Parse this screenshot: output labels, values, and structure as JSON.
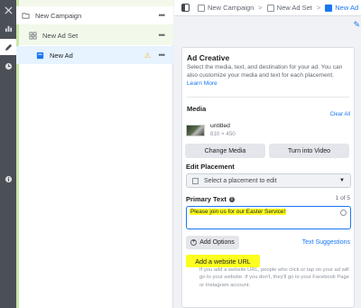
{
  "rail": {
    "items": [
      {
        "icon": "close-icon"
      },
      {
        "icon": "bar-chart-icon"
      },
      {
        "icon": "pencil-icon"
      },
      {
        "icon": "clock-icon"
      },
      {
        "icon": "info-icon"
      }
    ]
  },
  "tree": {
    "campaign": "New Campaign",
    "adset": "New Ad Set",
    "ad": "New Ad",
    "more": "•••",
    "warning": "⚠"
  },
  "breadcrumb": {
    "campaign": "New Campaign",
    "adset": "New Ad Set",
    "ad": "New Ad",
    "sep": ">"
  },
  "ad_creative": {
    "title": "Ad Creative",
    "description": "Select the media, text, and destination for your ad. You can also customize your media and text for each placement.",
    "learn_more": "Learn More"
  },
  "media": {
    "label": "Media",
    "clear_all": "Clear All",
    "file_name": "untitled",
    "file_dims": "810 × 450",
    "change_media": "Change Media",
    "turn_into_video": "Turn into Video"
  },
  "edit_placement": {
    "label": "Edit Placement",
    "placeholder": "Select a placement to edit"
  },
  "primary_text": {
    "label": "Primary Text",
    "info": "i",
    "count": "1 of 5",
    "value": "Please join us for our Easter Service!",
    "add_options": "Add Options",
    "text_suggestions": "Text Suggestions"
  },
  "website": {
    "add_url": "Add a website URL",
    "help": "If you add a website URL, people who click or tap on your ad will go to your website. If you don't, they'll go to your Facebook Page or Instagram account."
  },
  "colors": {
    "accent": "#1877f2",
    "highlight": "#fcff1f",
    "rail": "#4b4f56"
  }
}
